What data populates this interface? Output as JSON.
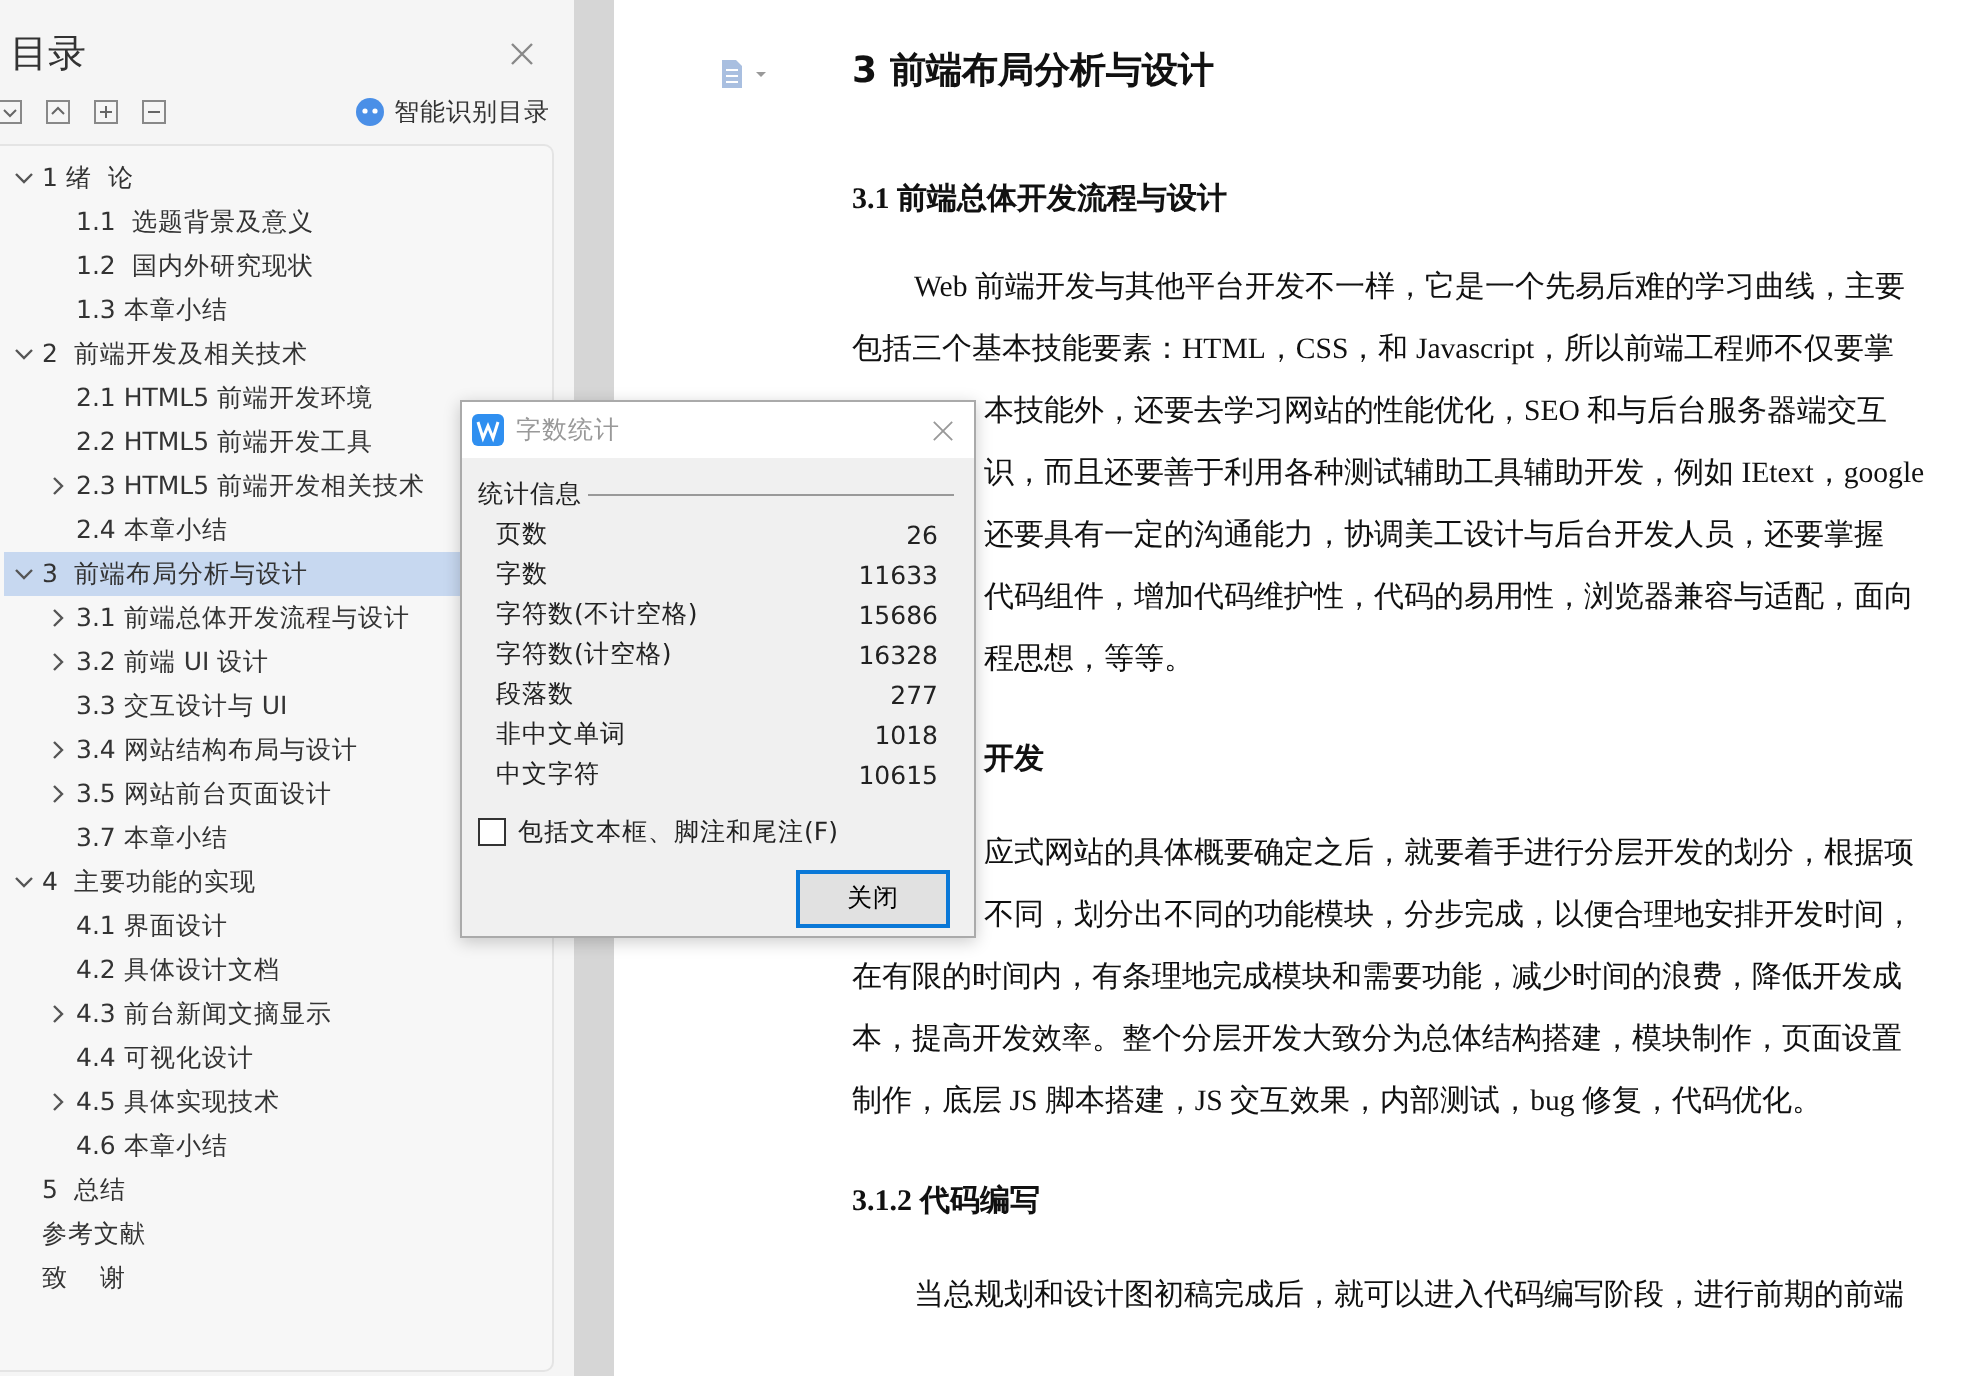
{
  "sidebar": {
    "title": "目录",
    "smart_button": "智能识别目录",
    "tree": [
      {
        "label": "1 绪  论",
        "expanded": true,
        "selected": false,
        "children": [
          {
            "label": "1.1  选题背景及意义",
            "selected": false
          },
          {
            "label": "1.2  国内外研究现状",
            "selected": false
          },
          {
            "label": "1.3 本章小结",
            "selected": false
          }
        ]
      },
      {
        "label": "2  前端开发及相关技术",
        "expanded": true,
        "selected": false,
        "children": [
          {
            "label": "2.1 HTML5 前端开发环境",
            "selected": false
          },
          {
            "label": "2.2 HTML5 前端开发工具",
            "selected": false
          },
          {
            "label": "2.3 HTML5 前端开发相关技术",
            "expanded": false,
            "selected": false
          },
          {
            "label": "2.4 本章小结",
            "selected": false
          }
        ]
      },
      {
        "label": "3  前端布局分析与设计",
        "expanded": true,
        "selected": true,
        "children": [
          {
            "label": "3.1 前端总体开发流程与设计",
            "expanded": false,
            "selected": false
          },
          {
            "label": "3.2 前端 UI 设计",
            "expanded": false,
            "selected": false
          },
          {
            "label": "3.3 交互设计与 UI",
            "selected": false
          },
          {
            "label": "3.4 网站结构布局与设计",
            "expanded": false,
            "selected": false
          },
          {
            "label": "3.5 网站前台页面设计",
            "expanded": false,
            "selected": false
          },
          {
            "label": "3.7 本章小结",
            "selected": false
          }
        ]
      },
      {
        "label": "4  主要功能的实现",
        "expanded": true,
        "selected": false,
        "children": [
          {
            "label": "4.1 界面设计",
            "selected": false
          },
          {
            "label": "4.2 具体设计文档",
            "selected": false
          },
          {
            "label": "4.3 前台新闻文摘显示",
            "expanded": false,
            "selected": false
          },
          {
            "label": "4.4 可视化设计",
            "selected": false
          },
          {
            "label": "4.5 具体实现技术",
            "expanded": false,
            "selected": false
          },
          {
            "label": "4.6 本章小结",
            "selected": false
          }
        ]
      },
      {
        "label": "5  总结",
        "selected": false
      },
      {
        "label": "参考文献",
        "selected": false
      },
      {
        "label": "致    谢",
        "selected": false
      }
    ]
  },
  "document": {
    "blocks": [
      {
        "kind": "h1",
        "text": "3  前端布局分析与设计"
      },
      {
        "kind": "h2",
        "text": "3.1 前端总体开发流程与设计"
      },
      {
        "kind": "first",
        "text": "Web 前端开发与其他平台开发不一样，它是一个先易后难的学习曲线，主要"
      },
      {
        "kind": "line",
        "text": "包括三个基本技能要素：HTML，CSS，和 Javascript，所以前端工程师不仅要掌"
      },
      {
        "kind": "partial",
        "text": "本技能外，还要去学习网站的性能优化，SEO 和与后台服务器端交互"
      },
      {
        "kind": "partial",
        "text": "识，而且还要善于利用各种测试辅助工具辅助开发，例如 IEtext，google"
      },
      {
        "kind": "partial",
        "text": "还要具有一定的沟通能力，协调美工设计与后台开发人员，还要掌握"
      },
      {
        "kind": "partial",
        "text": "代码组件，增加代码维护性，代码的易用性，浏览器兼容与适配，面向"
      },
      {
        "kind": "partial",
        "text": "程思想，等等。"
      },
      {
        "kind": "h3partial",
        "text": "开发"
      },
      {
        "kind": "partial",
        "text": "应式网站的具体概要确定之后，就要着手进行分层开发的划分，根据项"
      },
      {
        "kind": "partial",
        "text": "不同，划分出不同的功能模块，分步完成，以便合理地安排开发时间，"
      },
      {
        "kind": "line",
        "text": "在有限的时间内，有条理地完成模块和需要功能，减少时间的浪费，降低开发成"
      },
      {
        "kind": "line",
        "text": "本，提高开发效率。整个分层开发大致分为总体结构搭建，模块制作，页面设置"
      },
      {
        "kind": "line",
        "text": "制作，底层 JS 脚本搭建，JS 交互效果，内部测试，bug 修复，代码优化。"
      },
      {
        "kind": "h3",
        "text": "3.1.2 代码编写"
      },
      {
        "kind": "first",
        "text": "当总规划和设计图初稿完成后，就可以进入代码编写阶段，进行前期的前端"
      }
    ]
  },
  "dialog": {
    "title": "字数统计",
    "section": "统计信息",
    "stats": [
      {
        "label": "页数",
        "value": "26"
      },
      {
        "label": "字数",
        "value": "11633"
      },
      {
        "label": "字符数(不计空格)",
        "value": "15686"
      },
      {
        "label": "字符数(计空格)",
        "value": "16328"
      },
      {
        "label": "段落数",
        "value": "277"
      },
      {
        "label": "非中文单词",
        "value": "1018"
      },
      {
        "label": "中文字符",
        "value": "10615"
      }
    ],
    "include_checkbox": {
      "label": "包括文本框、脚注和尾注(F)",
      "checked": false
    },
    "close_button": "关闭"
  }
}
